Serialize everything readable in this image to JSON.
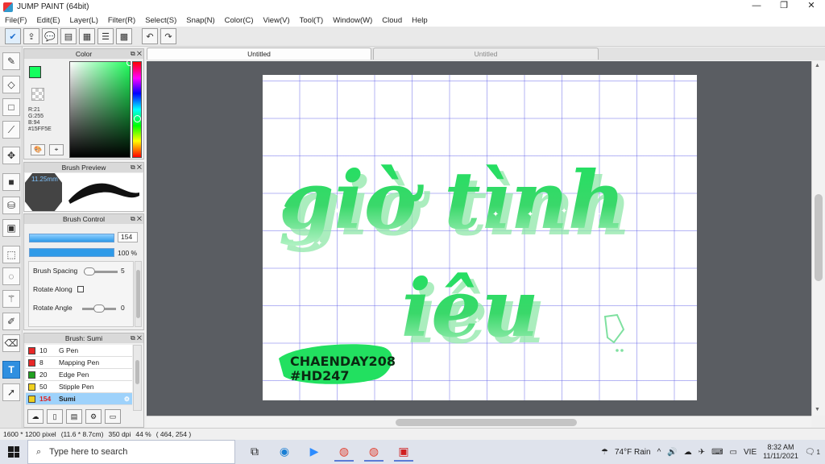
{
  "window": {
    "title": "JUMP PAINT (64bit)",
    "controls": [
      "—",
      "❐",
      "✕"
    ]
  },
  "menu": [
    "File(F)",
    "Edit(E)",
    "Layer(L)",
    "Filter(R)",
    "Select(S)",
    "Snap(N)",
    "Color(C)",
    "View(V)",
    "Tool(T)",
    "Window(W)",
    "Cloud",
    "Help"
  ],
  "toolbar": {
    "icons": [
      "check-cloud-icon",
      "share-icon",
      "comment-icon",
      "message-icon",
      "page-icon",
      "layers-list-icon",
      "grid-icon",
      "undo-icon",
      "redo-icon"
    ]
  },
  "tools": [
    "brush-icon",
    "eraser-icon",
    "rect-select-icon",
    "eyedropper-icon",
    "move-icon",
    "fill-rect-icon",
    "bucket-icon",
    "gradient-icon",
    "marquee-icon",
    "lasso-icon",
    "magic-wand-icon",
    "select-pen-icon",
    "select-eraser-icon",
    "text-icon",
    "operation-icon"
  ],
  "panels": {
    "color": {
      "title": "Color",
      "fg_color": "#15FF5E",
      "r": "R:21",
      "g": "G:255",
      "b": "B:94",
      "hex": "#15FF5E"
    },
    "brush_preview": {
      "title": "Brush Preview",
      "size_label": "11.25mm"
    },
    "brush_control": {
      "title": "Brush Control",
      "size_value": "154",
      "opacity_value": "100 %",
      "opacity_fraction": 1.0,
      "spacing_label": "Brush Spacing",
      "spacing_value": "5",
      "rotate_along_label": "Rotate Along",
      "rotate_angle_label": "Rotate Angle",
      "rotate_angle_value": "0"
    },
    "brush_list": {
      "title": "Brush: Sumi",
      "items": [
        {
          "num": "10",
          "name": "G Pen",
          "color": "#e82727"
        },
        {
          "num": "8",
          "name": "Mapping Pen",
          "color": "#e82727"
        },
        {
          "num": "20",
          "name": "Edge Pen",
          "color": "#20a020"
        },
        {
          "num": "50",
          "name": "Stipple Pen",
          "color": "#f0d020"
        },
        {
          "num": "154",
          "name": "Sumi",
          "color": "#f0d020",
          "selected": true
        }
      ]
    }
  },
  "tabs": [
    {
      "label": "Untitled",
      "active": true
    },
    {
      "label": "Untitled",
      "active": false
    }
  ],
  "canvas": {
    "line1": "giờ tình",
    "line2": "iêu",
    "sticker_line1": "CHAENDAY208",
    "sticker_line2": "#HD247",
    "lettering_color": "#2ad45a"
  },
  "status": {
    "size": "1600 * 1200 pixel",
    "physical": "(11.6 * 8.7cm)",
    "dpi": "350 dpi",
    "zoom": "44 %",
    "cursor": "( 464, 254 )"
  },
  "taskbar": {
    "search_placeholder": "Type here to search",
    "weather": "74°F  Rain",
    "lang": "VIE",
    "time": "8:32 AM",
    "date": "11/11/2021",
    "notifications": "1"
  }
}
